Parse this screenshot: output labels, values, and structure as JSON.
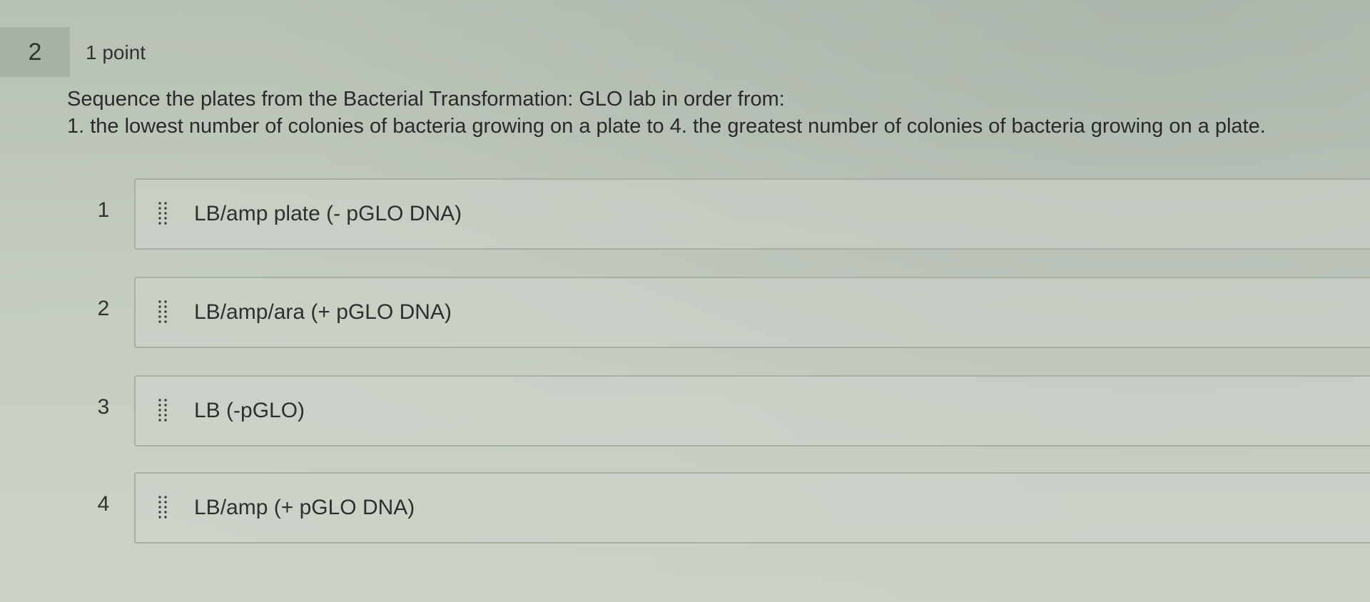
{
  "question": {
    "number": "2",
    "points": "1 point",
    "prompt_line1": "Sequence the plates from the Bacterial Transformation: GLO lab in order from:",
    "prompt_line2": "1. the lowest number of colonies of bacteria growing on a plate to 4. the greatest number of colonies of bacteria growing on a plate."
  },
  "sequence": {
    "items": [
      {
        "position": "1",
        "label": "LB/amp plate (- pGLO DNA)",
        "icon": "drag-handle-icon"
      },
      {
        "position": "2",
        "label": "LB/amp/ara (+ pGLO DNA)",
        "icon": "drag-handle-icon"
      },
      {
        "position": "3",
        "label": "LB (-pGLO)",
        "icon": "drag-handle-icon"
      },
      {
        "position": "4",
        "label": "LB/amp (+ pGLO DNA)",
        "icon": "drag-handle-icon"
      }
    ]
  },
  "colors": {
    "background": "#c1c9bf",
    "question_number_bg": "#a9b2a7",
    "card_border": "#a7b0a5",
    "text": "#2b3029"
  }
}
